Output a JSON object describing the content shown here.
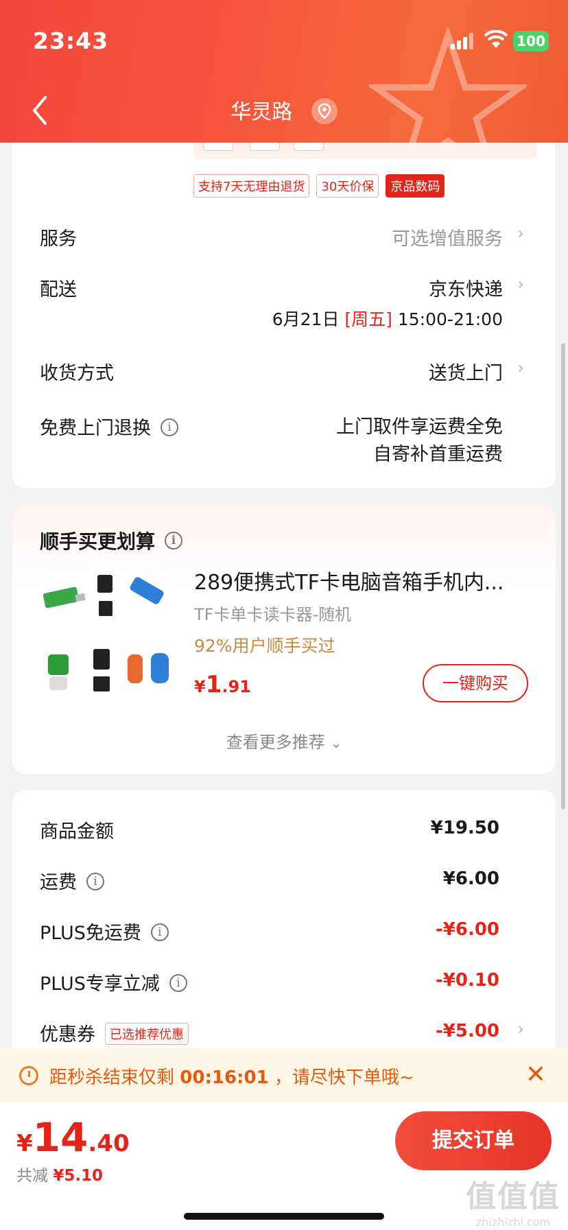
{
  "status_bar": {
    "time": "23:43",
    "battery": "100"
  },
  "header": {
    "title": "华灵路"
  },
  "tags": [
    "支持7天无理由退货",
    "30天价保",
    "京品数码"
  ],
  "service": {
    "label": "服务",
    "value": "可选增值服务"
  },
  "delivery": {
    "label": "配送",
    "carrier": "京东快递",
    "date": "6月21日",
    "weekday": "[周五]",
    "window": "15:00-21:00"
  },
  "receive": {
    "label": "收货方式",
    "value": "送货上门"
  },
  "free_return": {
    "label": "免费上门退换",
    "line1": "上门取件享运费全免",
    "line2": "自寄补首重运费"
  },
  "addon": {
    "title": "顺手买更划算",
    "product": {
      "name": "289便携式TF卡电脑音箱手机内...",
      "spec": "TF卡单卡读卡器-随机",
      "popularity": "92%用户顺手买过",
      "price_symbol": "¥",
      "price_int": "1",
      "price_dec": ".91",
      "buy_label": "一键购买"
    },
    "more_label": "查看更多推荐"
  },
  "summary": {
    "goods": {
      "label": "商品金额",
      "value": "¥19.50"
    },
    "shipping": {
      "label": "运费",
      "value": "¥6.00"
    },
    "plus_free_ship": {
      "label": "PLUS免运费",
      "value": "-¥6.00"
    },
    "plus_discount": {
      "label": "PLUS专享立减",
      "value": "-¥0.10"
    },
    "coupon": {
      "label": "优惠券",
      "tag": "已选推荐优惠",
      "value": "-¥5.00"
    }
  },
  "countdown": {
    "prefix": "距秒杀结束仅剩",
    "time": "00:16:01",
    "suffix": "，请尽快下单哦~"
  },
  "bottom": {
    "price_symbol": "¥",
    "price_int": "14",
    "price_dec": ".40",
    "saved_label": "共减",
    "saved_value": "¥5.10",
    "submit_label": "提交订单"
  },
  "watermark": {
    "big": "值值值",
    "small": "zhizhizhi.com"
  },
  "colors": {
    "brand_red": "#e1251b",
    "header_orange": "#f5573a",
    "banner_bg": "#fff6e5",
    "plus_gold": "#c68a3f"
  }
}
